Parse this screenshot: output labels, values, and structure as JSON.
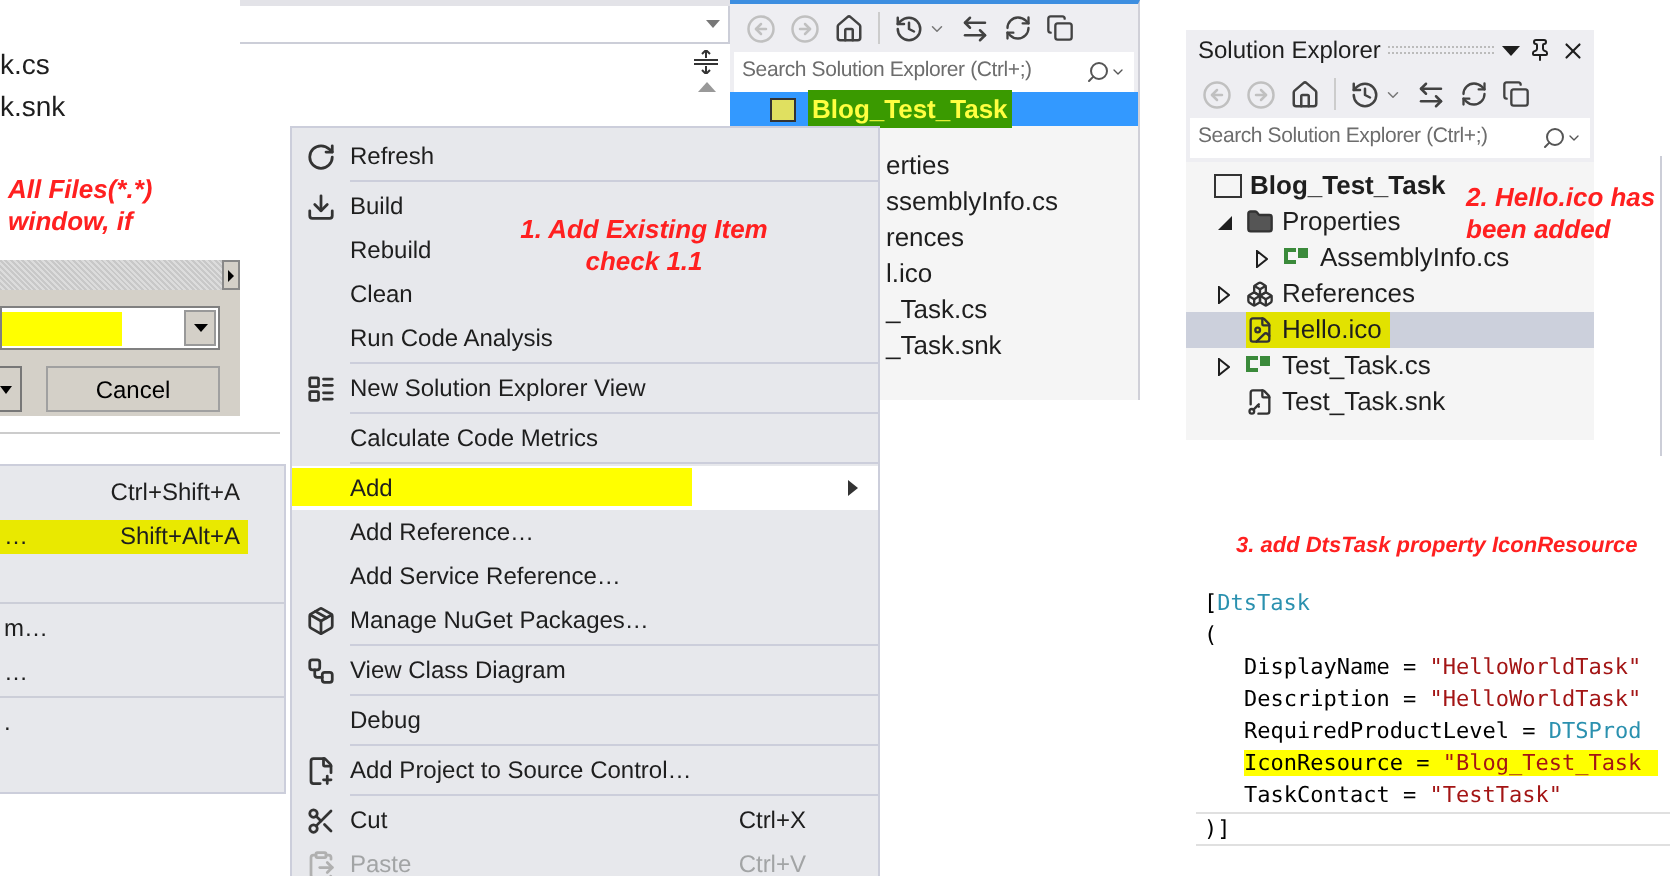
{
  "left_panel": {
    "files": [
      "k.cs",
      "k.snk"
    ],
    "note_lines": [
      "All Files(*.*)",
      "window, if"
    ]
  },
  "dialog": {
    "cancel": "Cancel"
  },
  "submenu": {
    "items": [
      {
        "kind": "item",
        "shortcut": "Ctrl+Shift+A",
        "selected": false
      },
      {
        "kind": "item",
        "label": "…",
        "shortcut": "Shift+Alt+A",
        "selected": true
      },
      {
        "kind": "separator"
      },
      {
        "kind": "item",
        "label": "m…",
        "selected": false
      },
      {
        "kind": "item",
        "label": "…",
        "selected": false
      },
      {
        "kind": "separator"
      },
      {
        "kind": "item",
        "label": ".",
        "selected": false
      }
    ]
  },
  "context_menu": {
    "items": [
      {
        "kind": "item",
        "label": "Refresh",
        "selected": false,
        "disabled": false
      },
      {
        "kind": "separator"
      },
      {
        "kind": "item",
        "label": "Build",
        "selected": false,
        "disabled": false
      },
      {
        "kind": "item",
        "label": "Rebuild",
        "selected": false,
        "disabled": false
      },
      {
        "kind": "item",
        "label": "Clean",
        "selected": false,
        "disabled": false
      },
      {
        "kind": "item",
        "label": "Run Code Analysis",
        "selected": false,
        "disabled": false
      },
      {
        "kind": "separator"
      },
      {
        "kind": "item",
        "label": "New Solution Explorer View",
        "selected": false,
        "disabled": false
      },
      {
        "kind": "separator"
      },
      {
        "kind": "item",
        "label": "Calculate Code Metrics",
        "selected": false,
        "disabled": false
      },
      {
        "kind": "separator"
      },
      {
        "kind": "submenu",
        "label": "Add",
        "selected": true,
        "disabled": false
      },
      {
        "kind": "item",
        "label": "Add Reference…",
        "selected": false,
        "disabled": false
      },
      {
        "kind": "item",
        "label": "Add Service Reference…",
        "selected": false,
        "disabled": false
      },
      {
        "kind": "item",
        "label": "Manage NuGet Packages…",
        "selected": false,
        "disabled": false
      },
      {
        "kind": "separator"
      },
      {
        "kind": "item",
        "label": "View Class Diagram",
        "selected": false,
        "disabled": false
      },
      {
        "kind": "separator"
      },
      {
        "kind": "item",
        "label": "Debug",
        "selected": false,
        "disabled": false
      },
      {
        "kind": "separator"
      },
      {
        "kind": "item",
        "label": "Add Project to Source Control…",
        "selected": false,
        "disabled": false
      },
      {
        "kind": "separator"
      },
      {
        "kind": "item",
        "label": "Cut",
        "shortcut": "Ctrl+X",
        "selected": false,
        "disabled": false
      },
      {
        "kind": "item",
        "label": "Paste",
        "shortcut": "Ctrl+V",
        "selected": false,
        "disabled": true
      }
    ]
  },
  "annotation_1": {
    "lines": [
      "1. Add Existing Item",
      "check 1.1"
    ]
  },
  "explorer_behind": {
    "search": {
      "placeholder": "Search Solution Explorer (Ctrl+;)"
    },
    "root": {
      "label": "Blog_Test_Task",
      "selected": true
    },
    "items": [
      "erties",
      "ssemblyInfo.cs",
      "rences",
      "l.ico",
      "_Task.cs",
      "_Task.snk"
    ]
  },
  "solution_explorer": {
    "title": "Solution Explorer",
    "search": {
      "placeholder": "Search Solution Explorer (Ctrl+;)"
    },
    "tree": [
      {
        "kind": "project",
        "label": "Blog_Test_Task",
        "has_toggle": false,
        "selected": false,
        "children": [
          {
            "kind": "folder",
            "label": "Properties",
            "has_toggle": true,
            "expanded": true,
            "selected": false,
            "children": [
              {
                "kind": "csharp",
                "label": "AssemblyInfo.cs",
                "has_toggle": true,
                "expanded": false,
                "selected": false
              }
            ]
          },
          {
            "kind": "references",
            "label": "References",
            "has_toggle": true,
            "expanded": false,
            "selected": false
          },
          {
            "kind": "icon_file",
            "label": "Hello.ico",
            "has_toggle": false,
            "selected": true
          },
          {
            "kind": "csharp",
            "label": "Test_Task.cs",
            "has_toggle": true,
            "expanded": false,
            "selected": false
          },
          {
            "kind": "key_file",
            "label": "Test_Task.snk",
            "has_toggle": false,
            "selected": false
          }
        ]
      }
    ]
  },
  "annotation_2": {
    "text": "2. Hello.ico has been added"
  },
  "annotation_3": {
    "text": "3. add DtsTask property IconResource"
  },
  "code": {
    "lines": [
      {
        "kind": "line",
        "highlighted": false,
        "tokens": [
          {
            "kind": "plain",
            "text": "["
          },
          {
            "kind": "type",
            "text": "DtsTask"
          }
        ]
      },
      {
        "kind": "line",
        "highlighted": false,
        "tokens": [
          {
            "kind": "plain",
            "text": "("
          }
        ]
      },
      {
        "kind": "argument",
        "highlighted": false,
        "tokens": [
          {
            "kind": "plain",
            "text": "DisplayName = "
          },
          {
            "kind": "string",
            "text": "\"HelloWorldTask\""
          }
        ]
      },
      {
        "kind": "argument",
        "highlighted": false,
        "tokens": [
          {
            "kind": "plain",
            "text": "Description = "
          },
          {
            "kind": "string",
            "text": "\"HelloWorldTask\""
          }
        ]
      },
      {
        "kind": "argument",
        "highlighted": false,
        "tokens": [
          {
            "kind": "plain",
            "text": "RequiredProductLevel = "
          },
          {
            "kind": "type",
            "text": "DTSProd"
          }
        ]
      },
      {
        "kind": "argument",
        "highlighted": true,
        "tokens": [
          {
            "kind": "plain",
            "text": "IconResource = "
          },
          {
            "kind": "string",
            "text": "\"Blog_Test_Task"
          }
        ]
      },
      {
        "kind": "argument",
        "highlighted": false,
        "tokens": [
          {
            "kind": "plain",
            "text": "TaskContact = "
          },
          {
            "kind": "string",
            "text": "\"TestTask\""
          }
        ]
      },
      {
        "kind": "line",
        "highlighted": false,
        "current": true,
        "tokens": [
          {
            "kind": "plain",
            "text": ")]"
          }
        ]
      }
    ]
  }
}
